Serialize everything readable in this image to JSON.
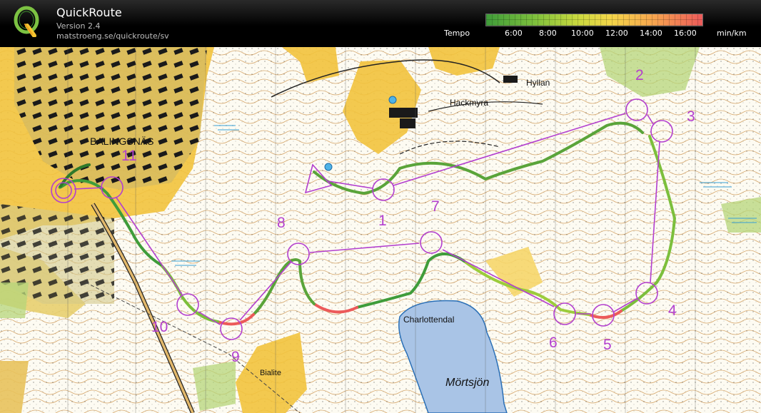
{
  "app": {
    "title": "QuickRoute",
    "version": "Version 2.4",
    "url": "matstroeng.se/quickroute/sv"
  },
  "legend": {
    "label": "Tempo",
    "ticks": [
      "6:00",
      "8:00",
      "10:00",
      "12:00",
      "14:00",
      "16:00"
    ],
    "unit": "min/km",
    "colors": [
      "#3f9c3a",
      "#7cbf3c",
      "#c9d93f",
      "#f4d54a",
      "#f6a34f",
      "#ec5a5a"
    ]
  },
  "map": {
    "place_names": {
      "balingsnas": "BALINGSNÄS",
      "hackmyra": "Hackmyra",
      "hyllan": "Hyllan",
      "charlottendal": "Charlottendal",
      "mortsjon": "Mörtsjön",
      "bialite": "Bialite"
    },
    "controls": [
      "1",
      "2",
      "3",
      "4",
      "5",
      "6",
      "7",
      "8",
      "9",
      "10",
      "11"
    ],
    "course_color": "#b33fcf",
    "route_colors": [
      "#3f9c3a",
      "#c9d93f",
      "#ec5a5a"
    ]
  }
}
